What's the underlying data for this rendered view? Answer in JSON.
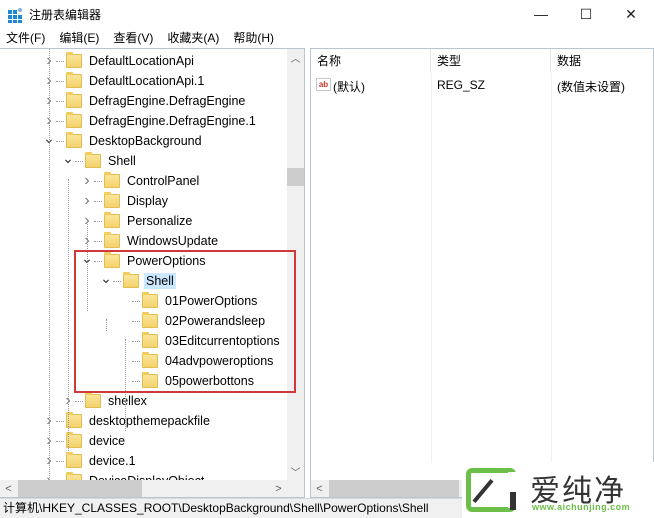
{
  "window": {
    "title": "注册表编辑器",
    "minimize_glyph": "—",
    "maximize_glyph": "☐",
    "close_glyph": "✕"
  },
  "menu": [
    "文件(F)",
    "编辑(E)",
    "查看(V)",
    "收藏夹(A)",
    "帮助(H)"
  ],
  "tree": {
    "items": [
      {
        "label": "DefaultLocationApi",
        "level": 0,
        "state": "collapsed"
      },
      {
        "label": "DefaultLocationApi.1",
        "level": 0,
        "state": "collapsed"
      },
      {
        "label": "DefragEngine.DefragEngine",
        "level": 0,
        "state": "collapsed"
      },
      {
        "label": "DefragEngine.DefragEngine.1",
        "level": 0,
        "state": "collapsed"
      },
      {
        "label": "DesktopBackground",
        "level": 0,
        "state": "expanded"
      },
      {
        "label": "Shell",
        "level": 1,
        "state": "expanded"
      },
      {
        "label": "ControlPanel",
        "level": 2,
        "state": "collapsed"
      },
      {
        "label": "Display",
        "level": 2,
        "state": "collapsed"
      },
      {
        "label": "Personalize",
        "level": 2,
        "state": "collapsed"
      },
      {
        "label": "WindowsUpdate",
        "level": 2,
        "state": "collapsed"
      },
      {
        "label": "PowerOptions",
        "level": 2,
        "state": "expanded"
      },
      {
        "label": "Shell",
        "level": 3,
        "state": "expanded",
        "selected": true
      },
      {
        "label": "01PowerOptions",
        "level": 4,
        "state": "leaf"
      },
      {
        "label": "02Powerandsleep",
        "level": 4,
        "state": "leaf"
      },
      {
        "label": "03Editcurrentoptions",
        "level": 4,
        "state": "leaf"
      },
      {
        "label": "04advpoweroptions",
        "level": 4,
        "state": "leaf"
      },
      {
        "label": "05powerbottons",
        "level": 4,
        "state": "leaf"
      },
      {
        "label": "shellex",
        "level": 1,
        "state": "collapsed"
      },
      {
        "label": "desktopthemepackfile",
        "level": 0,
        "state": "collapsed"
      },
      {
        "label": "device",
        "level": 0,
        "state": "collapsed"
      },
      {
        "label": "device.1",
        "level": 0,
        "state": "collapsed"
      },
      {
        "label": "DeviceDisplayObject",
        "level": 0,
        "state": "collapsed"
      }
    ]
  },
  "values": {
    "columns": [
      "名称",
      "类型",
      "数据"
    ],
    "rows": [
      {
        "icon": "ab",
        "name": "(默认)",
        "type": "REG_SZ",
        "data": "(数值未设置)"
      }
    ]
  },
  "status": {
    "path": "计算机\\HKEY_CLASSES_ROOT\\DesktopBackground\\Shell\\PowerOptions\\Shell"
  },
  "watermark": {
    "title": "爱纯净",
    "url": "www.aichunjing.com",
    "accent": "#6cc04a"
  },
  "colors": {
    "highlight_box": "#d0393a",
    "selection": "#cce8ff"
  }
}
